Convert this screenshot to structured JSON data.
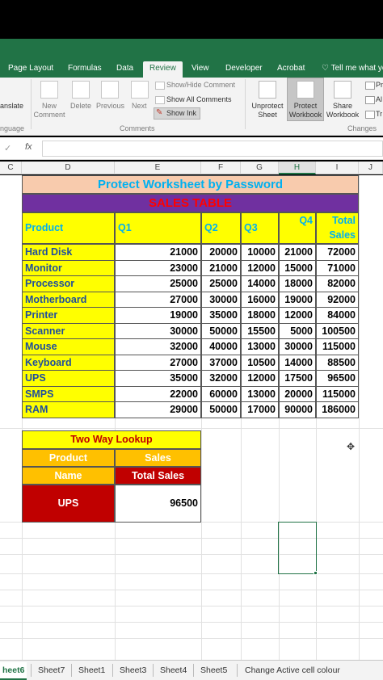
{
  "ribbon": {
    "tabs": [
      "Page Layout",
      "Formulas",
      "Data",
      "Review",
      "View",
      "Developer",
      "Acrobat",
      "Tell me what yo"
    ],
    "active_tab": "Review",
    "translate_label": "anslate",
    "language_label": "nguage",
    "new_comment": [
      "New",
      "Comment"
    ],
    "delete": "Delete",
    "previous": "Previous",
    "next": "Next",
    "show_hide_comment": "Show/Hide Comment",
    "show_all_comments": "Show All Comments",
    "show_ink": "Show Ink",
    "comments_group": "Comments",
    "unprotect_sheet": [
      "Unprotect",
      "Sheet"
    ],
    "protect_workbook": [
      "Protect",
      "Workbook"
    ],
    "share_workbook": [
      "Share",
      "Workbook"
    ],
    "changes_group": "Changes",
    "pr_label": "Pr",
    "al_label": "Al",
    "tr_label": "Tr"
  },
  "formula_bar": {
    "fx": "fx",
    "cancel": "✓",
    "value": ""
  },
  "columns": [
    "C",
    "D",
    "E",
    "F",
    "G",
    "H",
    "I",
    "J"
  ],
  "selected_column": "H",
  "title": "Protect Worksheet by Password",
  "subtitle": "SALES TABLE",
  "headers": {
    "product": "Product",
    "q1": "Q1",
    "q2": "Q2",
    "q3": "Q3",
    "q4": "Q4",
    "total": [
      "Total",
      "Sales"
    ]
  },
  "rows": [
    {
      "product": "Hard Disk",
      "q1": "21000",
      "q2": "20000",
      "q3": "10000",
      "q4": "21000",
      "total": "72000"
    },
    {
      "product": "Monitor",
      "q1": "23000",
      "q2": "21000",
      "q3": "12000",
      "q4": "15000",
      "total": "71000"
    },
    {
      "product": "Processor",
      "q1": "25000",
      "q2": "25000",
      "q3": "14000",
      "q4": "18000",
      "total": "82000"
    },
    {
      "product": "Motherboard",
      "q1": "27000",
      "q2": "30000",
      "q3": "16000",
      "q4": "19000",
      "total": "92000"
    },
    {
      "product": "Printer",
      "q1": "19000",
      "q2": "35000",
      "q3": "18000",
      "q4": "12000",
      "total": "84000"
    },
    {
      "product": "Scanner",
      "q1": "30000",
      "q2": "50000",
      "q3": "15500",
      "q4": "5000",
      "total": "100500"
    },
    {
      "product": "Mouse",
      "q1": "32000",
      "q2": "40000",
      "q3": "13000",
      "q4": "30000",
      "total": "115000"
    },
    {
      "product": "Keyboard",
      "q1": "27000",
      "q2": "37000",
      "q3": "10500",
      "q4": "14000",
      "total": "88500"
    },
    {
      "product": "UPS",
      "q1": "35000",
      "q2": "32000",
      "q3": "12000",
      "q4": "17500",
      "total": "96500"
    },
    {
      "product": "SMPS",
      "q1": "22000",
      "q2": "60000",
      "q3": "13000",
      "q4": "20000",
      "total": "115000"
    },
    {
      "product": "RAM",
      "q1": "29000",
      "q2": "50000",
      "q3": "17000",
      "q4": "90000",
      "total": "186000"
    }
  ],
  "lookup": {
    "title": "Two Way Lookup",
    "product_label": "Product",
    "sales_label": "Sales",
    "name_label": "Name",
    "total_sales_label": "Total Sales",
    "product_value": "UPS",
    "result_value": "96500"
  },
  "sheet_tabs": [
    "heet6",
    "Sheet7",
    "Sheet1",
    "Sheet3",
    "Sheet4",
    "Sheet5",
    "Change Active cell colour"
  ],
  "active_sheet": "heet6",
  "colors": {
    "excel_green": "#217346",
    "title_bg": "#f8cbad",
    "title_text": "#00b0f0",
    "subtitle_bg": "#7030a0",
    "subtitle_text": "#ff0000",
    "header_bg": "#ffff00",
    "header_text": "#00b0f0",
    "product_text": "#1f4e9c",
    "lookup_orange": "#ffc000",
    "lookup_red": "#c00000"
  }
}
